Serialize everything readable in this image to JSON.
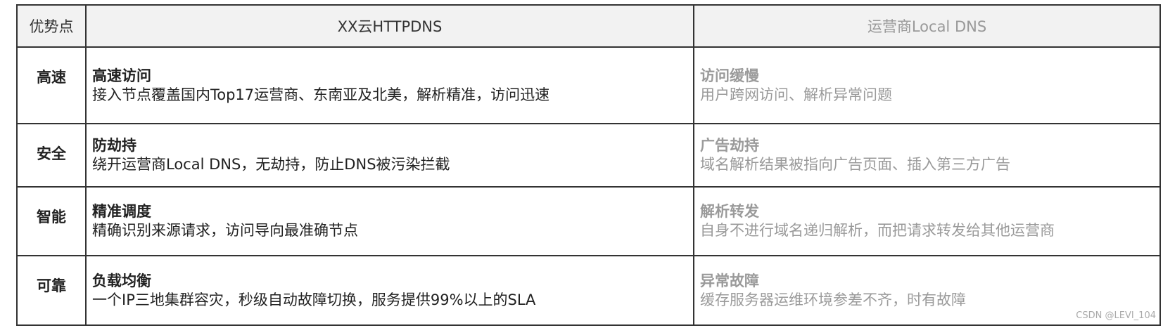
{
  "header": {
    "col0": "优势点",
    "col1": "XX云HTTPDNS",
    "col2": "运营商Local DNS"
  },
  "rows": [
    {
      "key": "高速",
      "a_title": "高速访问",
      "a_desc": "接入节点覆盖国内Top17运营商、东南亚及北美，解析精准，访问迅速",
      "b_title": "访问缓慢",
      "b_desc": "用户跨网访问、解析异常问题"
    },
    {
      "key": "安全",
      "a_title": "防劫持",
      "a_desc": "绕开运营商Local DNS，无劫持，防止DNS被污染拦截",
      "b_title": "广告劫持",
      "b_desc": "域名解析结果被指向广告页面、插入第三方广告"
    },
    {
      "key": "智能",
      "a_title": "精准调度",
      "a_desc": "精确识别来源请求，访问导向最准确节点",
      "b_title": "解析转发",
      "b_desc": "自身不进行域名递归解析，而把请求转发给其他运营商"
    },
    {
      "key": "可靠",
      "a_title": "负载均衡",
      "a_desc": "一个IP三地集群容灾，秒级自动故障切换，服务提供99%以上的SLA",
      "b_title": "异常故障",
      "b_desc": "缓存服务器运维环境参差不齐，时有故障"
    }
  ],
  "watermark": "CSDN @LEVI_104"
}
